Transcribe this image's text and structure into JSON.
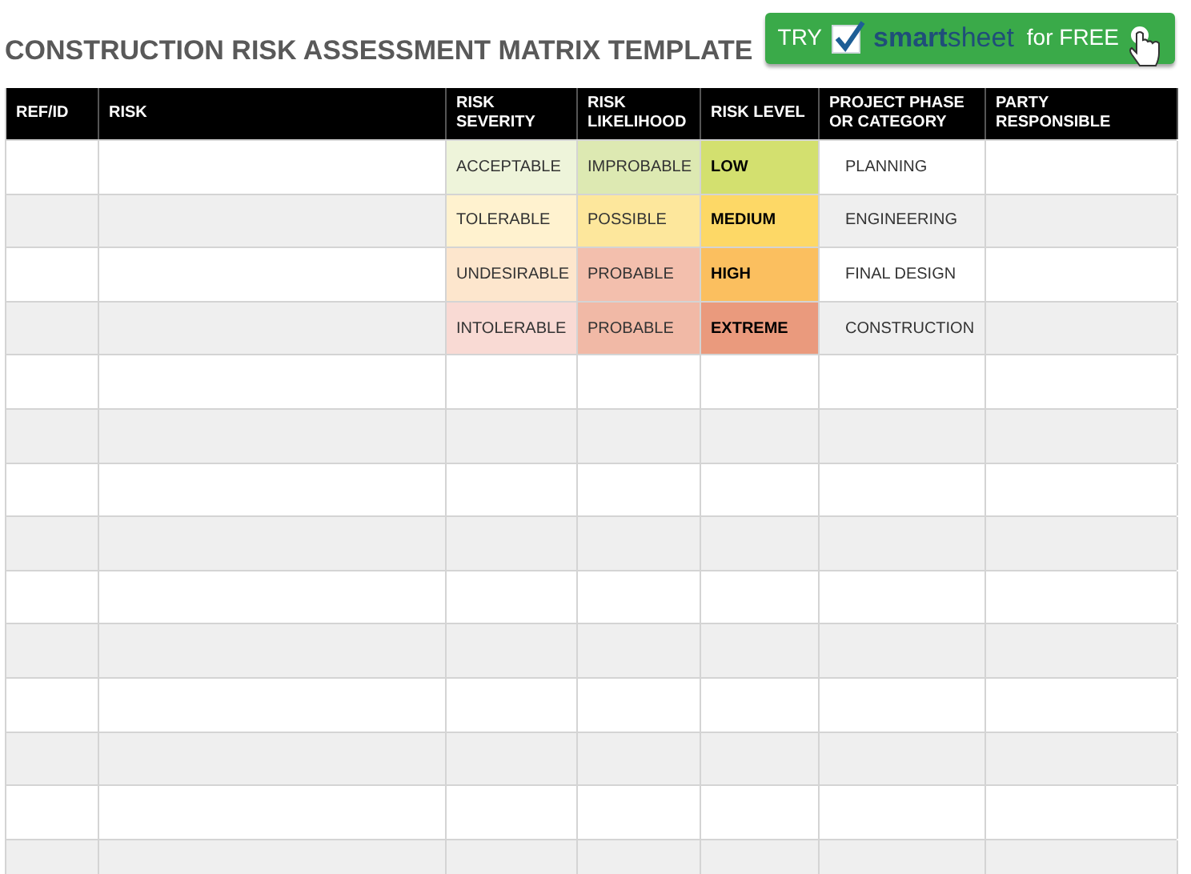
{
  "title": "CONSTRUCTION RISK ASSESSMENT MATRIX TEMPLATE",
  "promo": {
    "try": "TRY",
    "brand": "**smart**sheet",
    "offer": "for FREE"
  },
  "table": {
    "columns": [
      "REF/ID",
      "RISK",
      "RISK SEVERITY",
      "RISK LIKELIHOOD",
      "RISK LEVEL",
      "PROJECT PHASE OR CATEGORY",
      "PARTY RESPONSIBLE"
    ],
    "rows": [
      {
        "severity": {
          "text": "ACCEPTABLE",
          "color": "#eef4da"
        },
        "likelihood": {
          "text": "IMPROBABLE",
          "color": "#dde9b2"
        },
        "level": {
          "text": "LOW",
          "color": "#d3e06f"
        },
        "phase": "PLANNING"
      },
      {
        "severity": {
          "text": "TOLERABLE",
          "color": "#fff2cf"
        },
        "likelihood": {
          "text": "POSSIBLE",
          "color": "#fde79c"
        },
        "level": {
          "text": "MEDIUM",
          "color": "#fdd866"
        },
        "phase": "ENGINEERING"
      },
      {
        "severity": {
          "text": "UNDESIRABLE",
          "color": "#fde6cd"
        },
        "likelihood": {
          "text": "PROBABLE",
          "color": "#f3bfad"
        },
        "level": {
          "text": "HIGH",
          "color": "#fbbf5f"
        },
        "phase": "FINAL DESIGN"
      },
      {
        "severity": {
          "text": "INTOLERABLE",
          "color": "#f9dad4"
        },
        "likelihood": {
          "text": "PROBABLE",
          "color": "#f1b9a6"
        },
        "level": {
          "text": "EXTREME",
          "color": "#ea9a7d"
        },
        "phase": "CONSTRUCTION"
      }
    ]
  }
}
